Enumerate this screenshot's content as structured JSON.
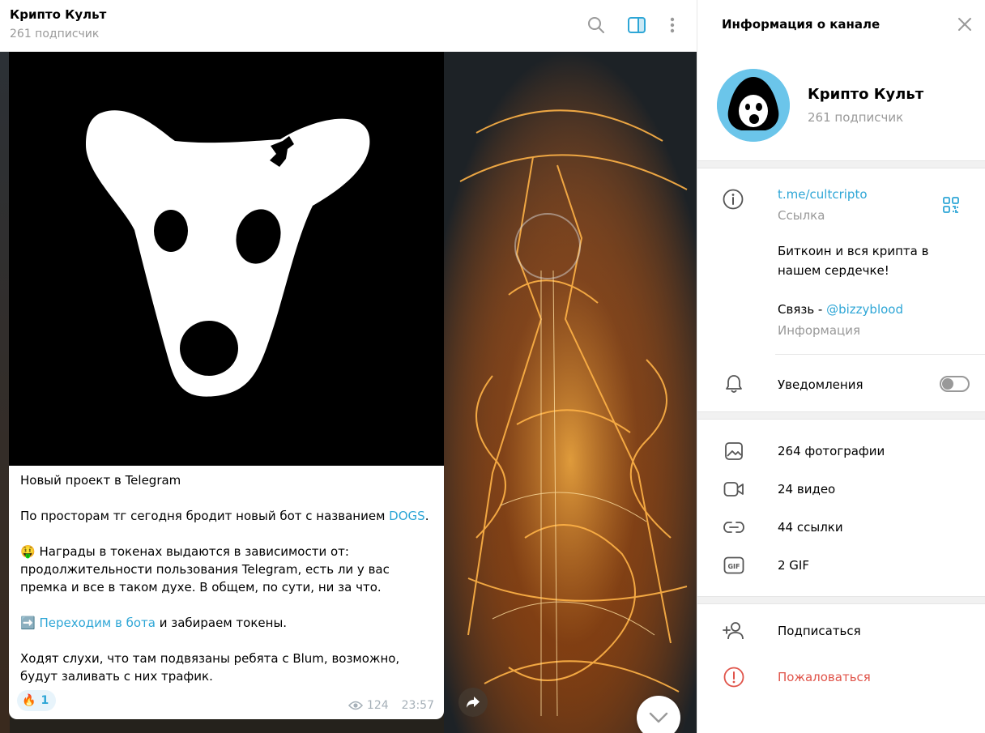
{
  "header": {
    "channel_title": "Крипто Культ",
    "subtitle": "261 подписчик"
  },
  "post": {
    "paragraphs": {
      "p1": "Новый проект в Telegram",
      "p2_text": "По просторам тг сегодня бродит новый бот с названием ",
      "p2_link": "DOGS",
      "p2_end": ".",
      "p3_emoji": "🤑",
      "p3_text": " Награды в токенах выдаются в зависимости от: продолжительности пользования Telegram, есть ли у вас премка и все в таком духе. В общем, по сути, ни за что.",
      "p4_emoji": "➡️",
      "p4_link": "Переходим в бота",
      "p4_text": " и забираем токены.",
      "p5": "Ходят слухи, что там подвязаны ребята с Blum, возможно, будут заливать с них трафик."
    },
    "reaction": {
      "emoji": "🔥",
      "count": "1"
    },
    "views": "124",
    "time": "23:57"
  },
  "info_panel": {
    "title": "Информация о канале",
    "channel_name": "Крипто Культ",
    "subscribers": "261 подписчик",
    "link": "t.me/cultcripto",
    "link_label": "Ссылка",
    "description_line1": "Биткоин и вся крипта в",
    "description_line2": "нашем сердечке!",
    "contact_prefix": "Связь - ",
    "contact_handle": "@bizzyblood",
    "description_label": "Информация",
    "notifications_label": "Уведомления",
    "notifications_on": false,
    "media": [
      {
        "icon": "photo-icon",
        "label": "264 фотографии"
      },
      {
        "icon": "video-icon",
        "label": "24 видео"
      },
      {
        "icon": "link-icon",
        "label": "44 ссылки"
      },
      {
        "icon": "gif-icon",
        "label": "2 GIF"
      }
    ],
    "subscribe_label": "Подписаться",
    "report_label": "Пожаловаться",
    "colors": {
      "accent": "#2ea6d6",
      "danger": "#e0544a",
      "avatar_bg": "#6bc5ea"
    }
  }
}
